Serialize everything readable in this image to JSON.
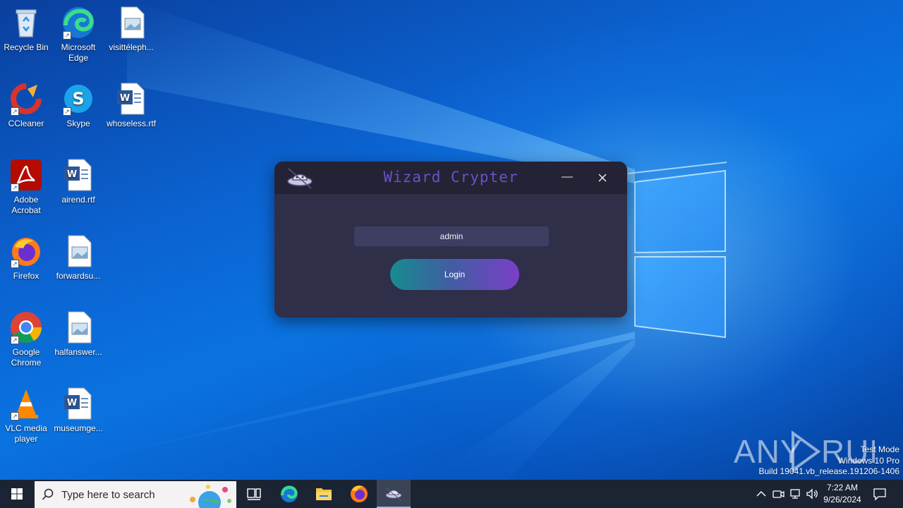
{
  "desktop": {
    "icons": [
      {
        "label": "Recycle Bin",
        "icon": "recycle-bin-icon"
      },
      {
        "label": "Microsoft Edge",
        "icon": "edge-icon"
      },
      {
        "label": "visittéleph...",
        "icon": "image-file-icon"
      },
      {
        "label": "CCleaner",
        "icon": "ccleaner-icon"
      },
      {
        "label": "Skype",
        "icon": "skype-icon"
      },
      {
        "label": "whoseless.rtf",
        "icon": "word-doc-icon"
      },
      {
        "label": "Adobe Acrobat",
        "icon": "acrobat-icon"
      },
      {
        "label": "airend.rtf",
        "icon": "word-doc-icon"
      },
      {
        "label": "Firefox",
        "icon": "firefox-icon"
      },
      {
        "label": "forwardsu...",
        "icon": "image-file-icon"
      },
      {
        "label": "Google Chrome",
        "icon": "chrome-icon"
      },
      {
        "label": "halfanswer...",
        "icon": "image-file-icon"
      },
      {
        "label": "VLC media player",
        "icon": "vlc-icon"
      },
      {
        "label": "museumge...",
        "icon": "word-doc-icon"
      }
    ]
  },
  "dialog": {
    "title": "Wizard Crypter",
    "username_value": "admin",
    "login_label": "Login",
    "minimize_glyph": "—",
    "close_glyph": "✕",
    "colors": {
      "background": "#2f2f4a",
      "titlebar": "#232335",
      "title_text": "#6b52c8",
      "button_start": "#178c8e",
      "button_end": "#7b3fc7"
    }
  },
  "watermark": {
    "text": "ANY RUN",
    "lines": [
      "Test Mode",
      "Windows 10 Pro",
      "Build 19041.vb_release.191206-1406"
    ]
  },
  "taskbar": {
    "search_placeholder": "Type here to search",
    "pinned": [
      "task-view-icon",
      "edge-icon",
      "file-explorer-icon",
      "firefox-icon",
      "wizard-crypter-icon"
    ],
    "tray": [
      "chevron-up-icon",
      "meet-now-icon",
      "network-icon",
      "volume-icon"
    ],
    "time": "7:22 AM",
    "date": "9/26/2024"
  }
}
